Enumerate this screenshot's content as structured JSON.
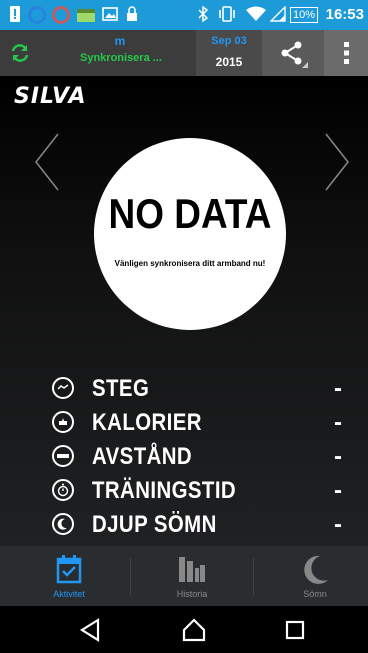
{
  "status_bar": {
    "time": "16:53",
    "battery": "10%",
    "icons": [
      "alert-icon",
      "circle-s-icon",
      "circle-s-icon",
      "app-icon",
      "image-icon",
      "lock-icon",
      "bluetooth-icon",
      "vibrate-icon",
      "wifi-icon",
      "signal-icon"
    ]
  },
  "action_bar": {
    "sync_label": "Synkronisera ...",
    "sync_top": "m",
    "date_top": "Sep 03",
    "date_year": "2015",
    "accent": "#2196f3",
    "sync_color": "#25c84a"
  },
  "brand": {
    "logo": "SILVA"
  },
  "summary": {
    "headline": "NO DATA",
    "message": "Vänligen synkronisera ditt armband nu!"
  },
  "stats": [
    {
      "label": "STEG",
      "value": "-",
      "icon": "steps-icon"
    },
    {
      "label": "KALORIER",
      "value": "-",
      "icon": "calories-icon"
    },
    {
      "label": "AVSTÅND",
      "value": "-",
      "icon": "distance-icon"
    },
    {
      "label": "TRÄNINGSTID",
      "value": "-",
      "icon": "stopwatch-icon"
    },
    {
      "label": "DJUP SÖMN",
      "value": "-",
      "icon": "moon-icon"
    }
  ],
  "tabs": [
    {
      "label": "Aktivitet",
      "icon": "calendar-icon",
      "active": true
    },
    {
      "label": "Historia",
      "icon": "bar-chart-icon",
      "active": false
    },
    {
      "label": "Sömn",
      "icon": "moon-icon",
      "active": false
    }
  ],
  "nav": [
    "back-icon",
    "home-icon",
    "recents-icon"
  ]
}
